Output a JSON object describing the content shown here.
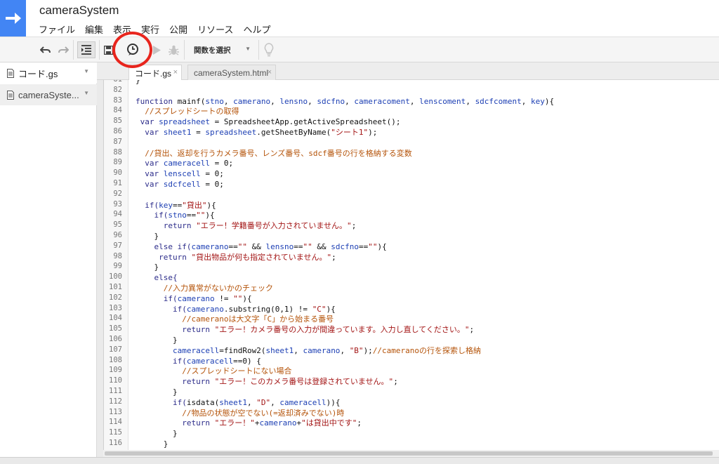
{
  "app": {
    "title": "cameraSystem"
  },
  "menu": [
    "ファイル",
    "編集",
    "表示",
    "実行",
    "公開",
    "リソース",
    "ヘルプ"
  ],
  "toolbar": {
    "function_select": "関数を選択",
    "icons": [
      "undo-icon",
      "redo-icon",
      "indent-icon",
      "save-icon",
      "clock-trigger-icon",
      "run-icon",
      "debug-icon",
      "lightbulb-icon"
    ],
    "highlight_color": "#e8251d"
  },
  "sidebar": {
    "files": [
      {
        "name": "コード.gs"
      },
      {
        "name": "cameraSyste..."
      }
    ]
  },
  "tabs": [
    {
      "label": "コード.gs",
      "close": "×"
    },
    {
      "label": "cameraSystem.html",
      "close": "×"
    }
  ],
  "editor": {
    "line_numbers": [
      "81",
      "82",
      "83",
      "84",
      "85",
      "86",
      "87",
      "88",
      "89",
      "90",
      "91",
      "92",
      "93",
      "94",
      "95",
      "96",
      "97",
      "98",
      "99",
      "100",
      "101",
      "102",
      "103",
      "104",
      "105",
      "106",
      "107",
      "108",
      "109",
      "110",
      "111",
      "112",
      "113",
      "114",
      "115",
      "116"
    ],
    "lines": [
      [
        {
          "t": "}",
          "c": "pl"
        }
      ],
      [],
      [
        {
          "t": "function ",
          "c": "kw"
        },
        {
          "t": "mainf(",
          "c": "pl"
        },
        {
          "t": "stno",
          "c": "id"
        },
        {
          "t": ", ",
          "c": "pl"
        },
        {
          "t": "camerano",
          "c": "id"
        },
        {
          "t": ", ",
          "c": "pl"
        },
        {
          "t": "lensno",
          "c": "id"
        },
        {
          "t": ", ",
          "c": "pl"
        },
        {
          "t": "sdcfno",
          "c": "id"
        },
        {
          "t": ", ",
          "c": "pl"
        },
        {
          "t": "cameracoment",
          "c": "id"
        },
        {
          "t": ", ",
          "c": "pl"
        },
        {
          "t": "lenscoment",
          "c": "id"
        },
        {
          "t": ", ",
          "c": "pl"
        },
        {
          "t": "sdcfcoment",
          "c": "id"
        },
        {
          "t": ", ",
          "c": "pl"
        },
        {
          "t": "key",
          "c": "id"
        },
        {
          "t": "){",
          "c": "pl"
        }
      ],
      [
        {
          "t": "  //スプレッドシートの取得",
          "c": "cm"
        }
      ],
      [
        {
          "t": " var ",
          "c": "kw"
        },
        {
          "t": "spreadsheet",
          "c": "id"
        },
        {
          "t": " = SpreadsheetApp.getActiveSpreadsheet();",
          "c": "pl"
        }
      ],
      [
        {
          "t": "  var ",
          "c": "kw"
        },
        {
          "t": "sheet1",
          "c": "id"
        },
        {
          "t": " = ",
          "c": "pl"
        },
        {
          "t": "spreadsheet",
          "c": "id"
        },
        {
          "t": ".getSheetByName(",
          "c": "pl"
        },
        {
          "t": "\"シート1\"",
          "c": "st"
        },
        {
          "t": ");",
          "c": "pl"
        }
      ],
      [],
      [
        {
          "t": "  //貸出、返却を行うカメラ番号、レンズ番号、sdcf番号の行を格納する変数",
          "c": "cm"
        }
      ],
      [
        {
          "t": "  var ",
          "c": "kw"
        },
        {
          "t": "cameracell",
          "c": "id"
        },
        {
          "t": " = 0;",
          "c": "pl"
        }
      ],
      [
        {
          "t": "  var ",
          "c": "kw"
        },
        {
          "t": "lenscell",
          "c": "id"
        },
        {
          "t": " = 0;",
          "c": "pl"
        }
      ],
      [
        {
          "t": "  var ",
          "c": "kw"
        },
        {
          "t": "sdcfcell",
          "c": "id"
        },
        {
          "t": " = 0;",
          "c": "pl"
        }
      ],
      [],
      [
        {
          "t": "  if(",
          "c": "kw"
        },
        {
          "t": "key",
          "c": "id"
        },
        {
          "t": "==",
          "c": "pl"
        },
        {
          "t": "\"貸出\"",
          "c": "st"
        },
        {
          "t": "){",
          "c": "pl"
        }
      ],
      [
        {
          "t": "    if(",
          "c": "kw"
        },
        {
          "t": "stno",
          "c": "id"
        },
        {
          "t": "==",
          "c": "pl"
        },
        {
          "t": "\"\"",
          "c": "st"
        },
        {
          "t": "){",
          "c": "pl"
        }
      ],
      [
        {
          "t": "      return ",
          "c": "kw"
        },
        {
          "t": "\"エラー！学籍番号が入力されていません。\"",
          "c": "st"
        },
        {
          "t": ";",
          "c": "pl"
        }
      ],
      [
        {
          "t": "    }",
          "c": "pl"
        }
      ],
      [
        {
          "t": "    else if(",
          "c": "kw"
        },
        {
          "t": "camerano",
          "c": "id"
        },
        {
          "t": "==",
          "c": "pl"
        },
        {
          "t": "\"\"",
          "c": "st"
        },
        {
          "t": " && ",
          "c": "pl"
        },
        {
          "t": "lensno",
          "c": "id"
        },
        {
          "t": "==",
          "c": "pl"
        },
        {
          "t": "\"\"",
          "c": "st"
        },
        {
          "t": " && ",
          "c": "pl"
        },
        {
          "t": "sdcfno",
          "c": "id"
        },
        {
          "t": "==",
          "c": "pl"
        },
        {
          "t": "\"\"",
          "c": "st"
        },
        {
          "t": "){",
          "c": "pl"
        }
      ],
      [
        {
          "t": "     return ",
          "c": "kw"
        },
        {
          "t": "\"貸出物品が何も指定されていません。\"",
          "c": "st"
        },
        {
          "t": ";",
          "c": "pl"
        }
      ],
      [
        {
          "t": "    }",
          "c": "pl"
        }
      ],
      [
        {
          "t": "    else{",
          "c": "kw"
        }
      ],
      [
        {
          "t": "      //入力異常がないかのチェック",
          "c": "cm"
        }
      ],
      [
        {
          "t": "      if(",
          "c": "kw"
        },
        {
          "t": "camerano",
          "c": "id"
        },
        {
          "t": " != ",
          "c": "pl"
        },
        {
          "t": "\"\"",
          "c": "st"
        },
        {
          "t": "){",
          "c": "pl"
        }
      ],
      [
        {
          "t": "        if(",
          "c": "kw"
        },
        {
          "t": "camerano",
          "c": "id"
        },
        {
          "t": ".substring(0,1) != ",
          "c": "pl"
        },
        {
          "t": "\"C\"",
          "c": "st"
        },
        {
          "t": "){",
          "c": "pl"
        }
      ],
      [
        {
          "t": "          //cameranoは大文字「C」から始まる番号",
          "c": "cm"
        }
      ],
      [
        {
          "t": "          return ",
          "c": "kw"
        },
        {
          "t": "\"エラー！カメラ番号の入力が間違っています。入力し直してください。\"",
          "c": "st"
        },
        {
          "t": ";",
          "c": "pl"
        }
      ],
      [
        {
          "t": "        }",
          "c": "pl"
        }
      ],
      [
        {
          "t": "        ",
          "c": "pl"
        },
        {
          "t": "cameracell",
          "c": "id"
        },
        {
          "t": "=findRow2(",
          "c": "pl"
        },
        {
          "t": "sheet1",
          "c": "id"
        },
        {
          "t": ", ",
          "c": "pl"
        },
        {
          "t": "camerano",
          "c": "id"
        },
        {
          "t": ", ",
          "c": "pl"
        },
        {
          "t": "\"B\"",
          "c": "st"
        },
        {
          "t": ");",
          "c": "pl"
        },
        {
          "t": "//cameranoの行を探索し格納",
          "c": "cm"
        }
      ],
      [
        {
          "t": "        if(",
          "c": "kw"
        },
        {
          "t": "cameracell",
          "c": "id"
        },
        {
          "t": "==0) {",
          "c": "pl"
        }
      ],
      [
        {
          "t": "          //スプレッドシートにない場合",
          "c": "cm"
        }
      ],
      [
        {
          "t": "          return ",
          "c": "kw"
        },
        {
          "t": "\"エラー！このカメラ番号は登録されていません。\"",
          "c": "st"
        },
        {
          "t": ";",
          "c": "pl"
        }
      ],
      [
        {
          "t": "        }",
          "c": "pl"
        }
      ],
      [
        {
          "t": "        if(",
          "c": "kw"
        },
        {
          "t": "isdata(",
          "c": "pl"
        },
        {
          "t": "sheet1",
          "c": "id"
        },
        {
          "t": ", ",
          "c": "pl"
        },
        {
          "t": "\"D\"",
          "c": "st"
        },
        {
          "t": ", ",
          "c": "pl"
        },
        {
          "t": "cameracell",
          "c": "id"
        },
        {
          "t": ")){",
          "c": "pl"
        }
      ],
      [
        {
          "t": "          //物品の状態が空でない(=返却済みでない)時",
          "c": "cm"
        }
      ],
      [
        {
          "t": "          return ",
          "c": "kw"
        },
        {
          "t": "\"エラー！\"",
          "c": "st"
        },
        {
          "t": "+",
          "c": "pl"
        },
        {
          "t": "camerano",
          "c": "id"
        },
        {
          "t": "+",
          "c": "pl"
        },
        {
          "t": "\"は貸出中です\"",
          "c": "st"
        },
        {
          "t": ";",
          "c": "pl"
        }
      ],
      [
        {
          "t": "        }",
          "c": "pl"
        }
      ],
      [
        {
          "t": "      }",
          "c": "pl"
        }
      ]
    ]
  }
}
